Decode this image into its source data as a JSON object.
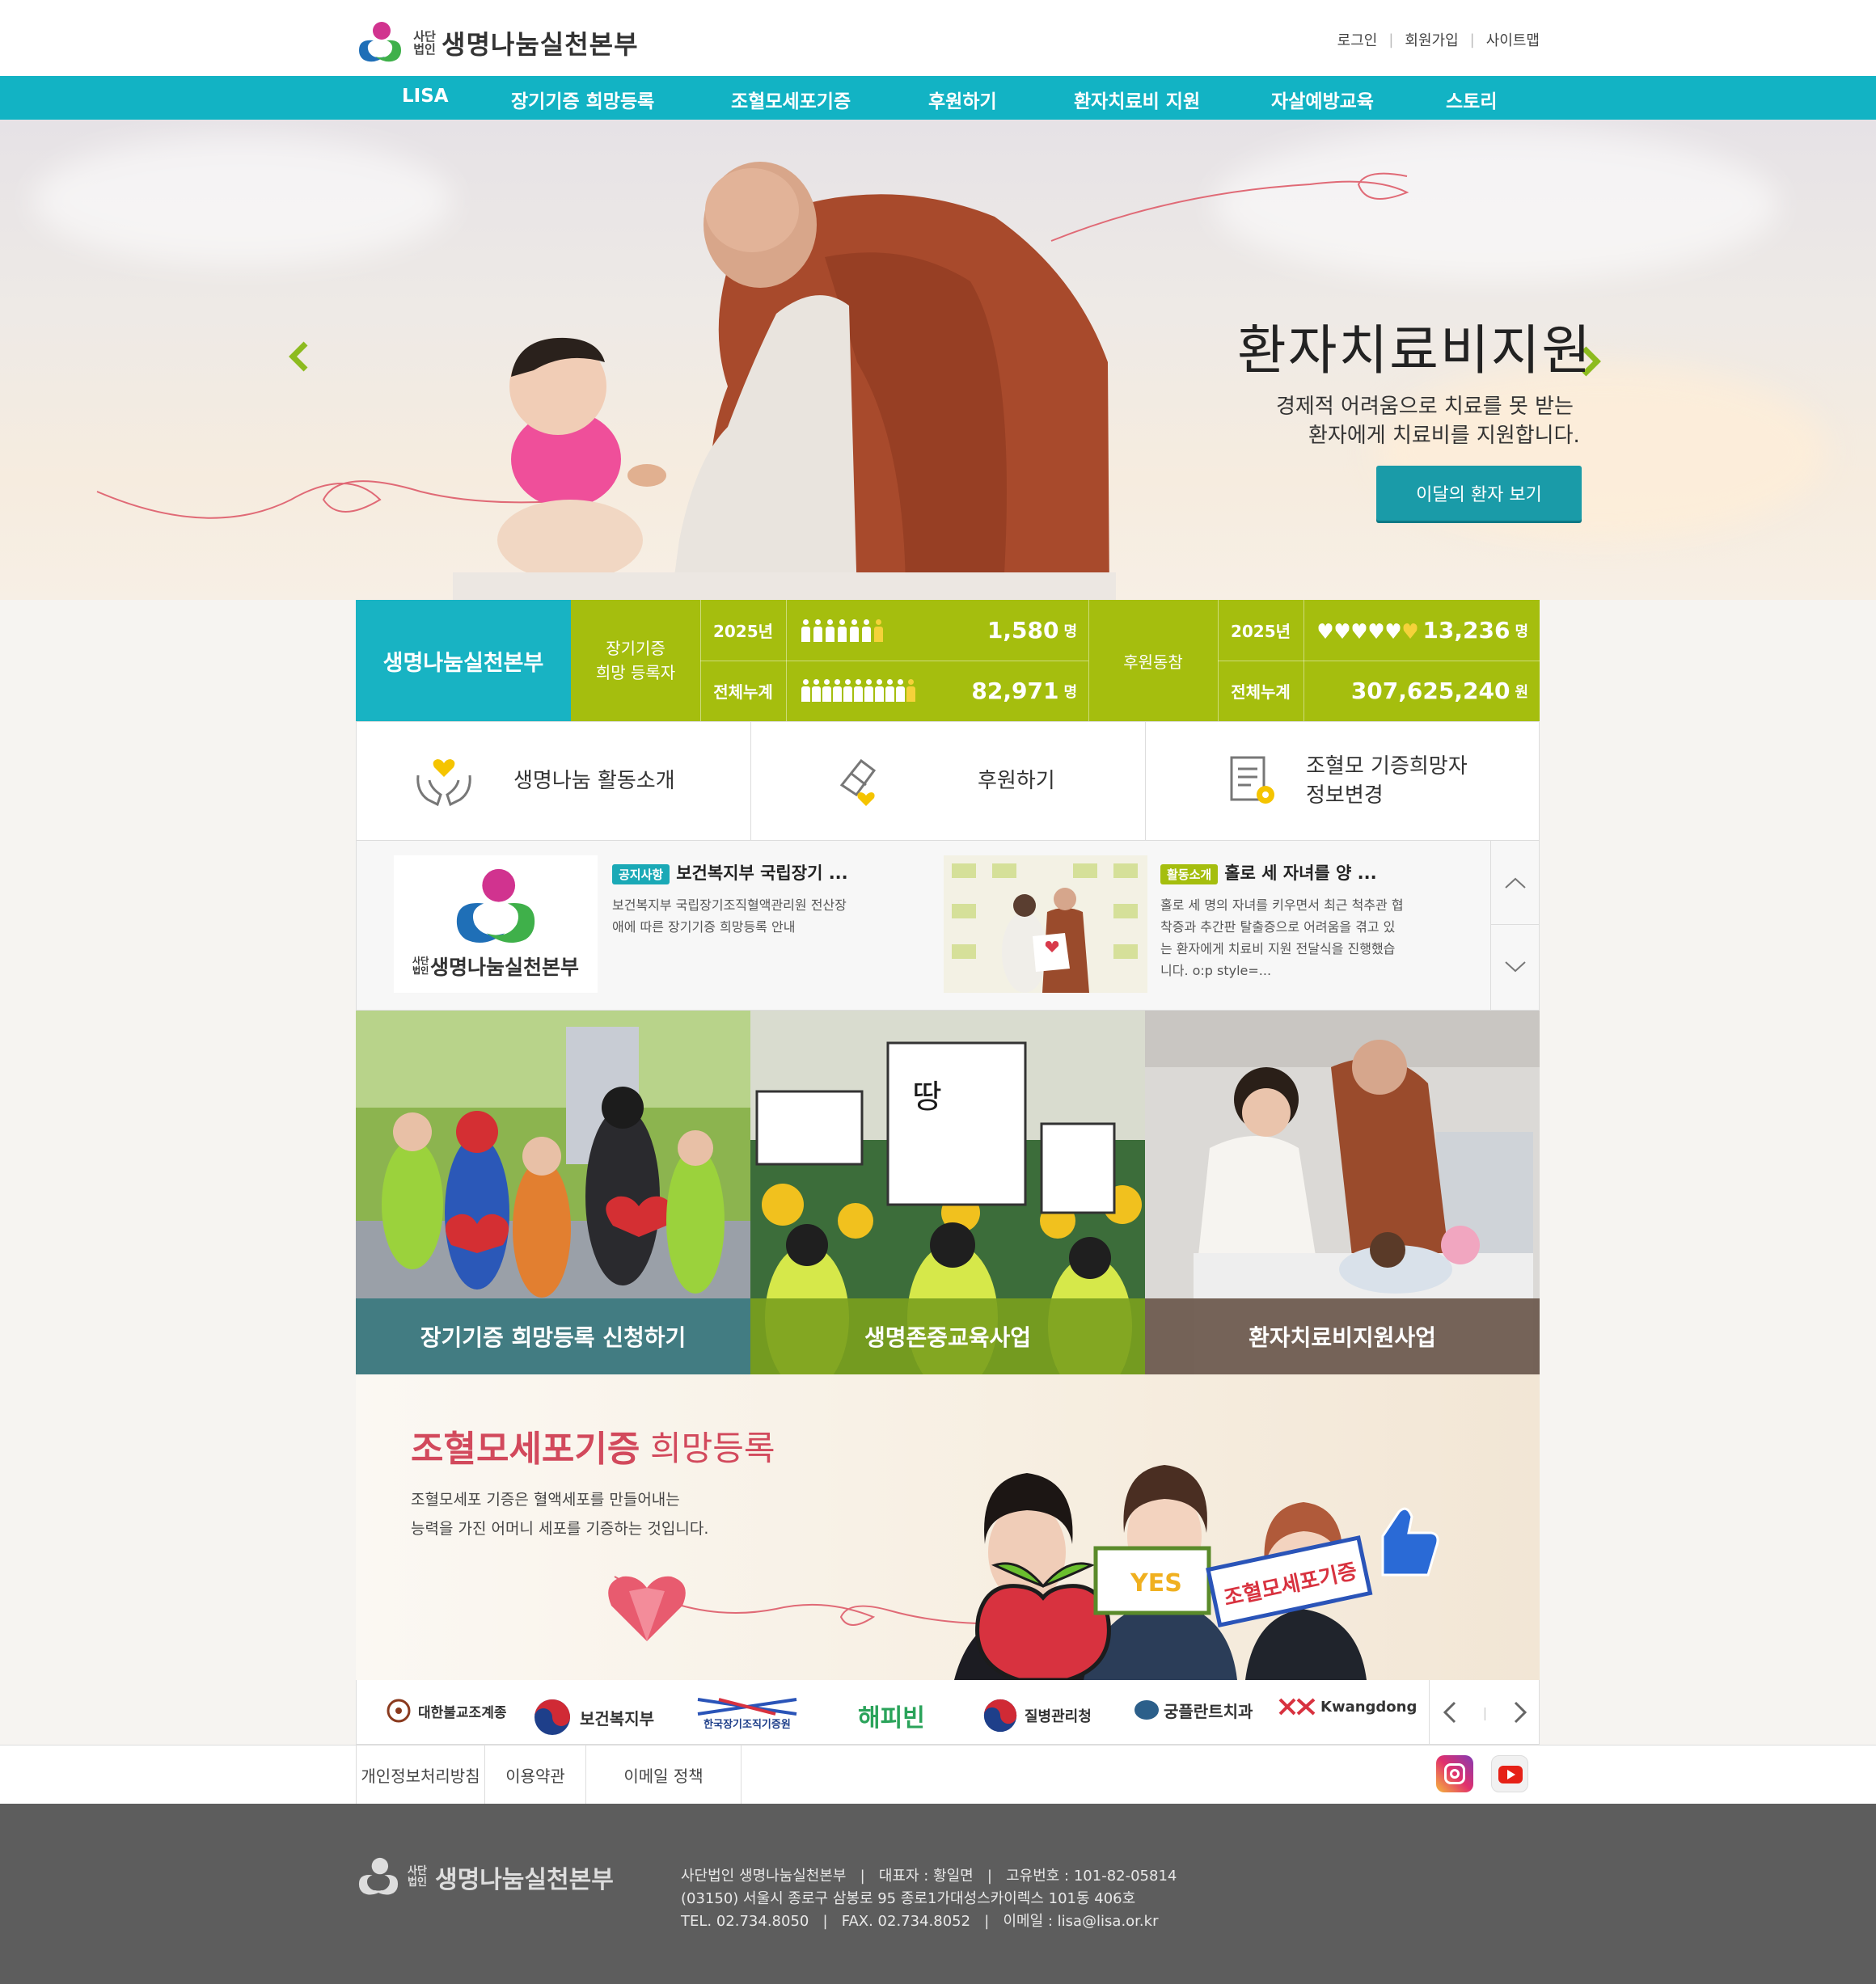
{
  "header": {
    "logo_small": "사단법인",
    "logo_name": "생명나눔실천본부",
    "util_links": [
      "로그인",
      "회원가입",
      "사이트맵"
    ]
  },
  "gnb": [
    "LISA",
    "장기기증 희망등록",
    "조혈모세포기증",
    "후원하기",
    "환자치료비 지원",
    "자살예방교육",
    "스토리"
  ],
  "hero": {
    "title": "환자치료비지원",
    "subtitle_line1": "경제적 어려움으로 치료를 못 받는",
    "subtitle_line2": "환자에게 치료비를 지원합니다.",
    "button": "이달의 환자 보기",
    "prev_icon": "chevron-left-icon",
    "next_icon": "chevron-right-icon"
  },
  "stats": {
    "org": "생명나눔실천본부",
    "organ_label_line1": "장기기증",
    "organ_label_line2": "희망 등록자",
    "organ_year": "2025년",
    "organ_year_value": "1,580",
    "organ_total_label": "전체누계",
    "organ_total_value": "82,971",
    "person_unit": "명",
    "support_label": "후원동참",
    "support_year": "2025년",
    "support_year_value": "13,236",
    "support_total_label": "전체누계",
    "support_total_value": "307,625,240",
    "won_unit": "원"
  },
  "quick": [
    {
      "label": "생명나눔 활동소개",
      "icon": "hands-heart-icon"
    },
    {
      "label": "후원하기",
      "icon": "donation-hand-icon"
    },
    {
      "label_line1": "조혈모 기증희망자",
      "label_line2": "정보변경",
      "icon": "document-gear-icon"
    }
  ],
  "news": [
    {
      "badge": "공지사항",
      "title": "보건복지부 국립장기 ...",
      "text_line1": "보건복지부 국립장기조직혈액관리원 전산장",
      "text_line2": "애에 따른 장기기증 희망등록 안내"
    },
    {
      "badge": "활동소개",
      "title": "홀로 세 자녀를 양 ...",
      "text_line1": "홀로 세 명의 자녀를 키우면서 최근 척추관 협",
      "text_line2": "착증과 추간판 탈출증으로 어려움을 겪고 있",
      "text_line3": "는 환자에게 치료비 지원 전달식을 진행했습",
      "text_line4": "니다. o:p style=..."
    }
  ],
  "tiles": [
    {
      "caption": "장기기증 희망등록 신청하기",
      "color": "#3b7f86"
    },
    {
      "caption": "생명존중교육사업",
      "color": "#7da322"
    },
    {
      "caption": "환자치료비지원사업",
      "color": "#6d5a4f"
    }
  ],
  "cord": {
    "title_bold": "조혈모세포기증",
    "title_light": "희망등록",
    "desc_line1": "조혈모세포 기증은 혈액세포를 만들어내는",
    "desc_line2": "능력을 가진 어머니 세포를 기증하는 것입니다.",
    "sign_yes": "YES",
    "sign_cord": "조혈모세포기증"
  },
  "partners": [
    "대한불교조계종",
    "보건복지부",
    "한국장기조직기증원",
    "해피빈",
    "질병관리청",
    "궁플란트치과",
    "Kwangdong"
  ],
  "footer_links": [
    "개인정보처리방침",
    "이용약관",
    "이메일 정책"
  ],
  "footer": {
    "line1": "사단법인 생명나눔실천본부   |   대표자 : 황일면   |   고유번호 : 101-82-05814",
    "line2": "(03150) 서울시 종로구 삼봉로 95 종로1가대성스카이렉스 101동 406호",
    "line3": "TEL. 02.734.8050   |   FAX. 02.734.8052   |   이메일 : lisa@lisa.or.kr"
  },
  "colors": {
    "teal": "#12b3c4",
    "green": "#a5be0e",
    "footer": "#5d5d5d",
    "accent_pink": "#d2495c"
  }
}
